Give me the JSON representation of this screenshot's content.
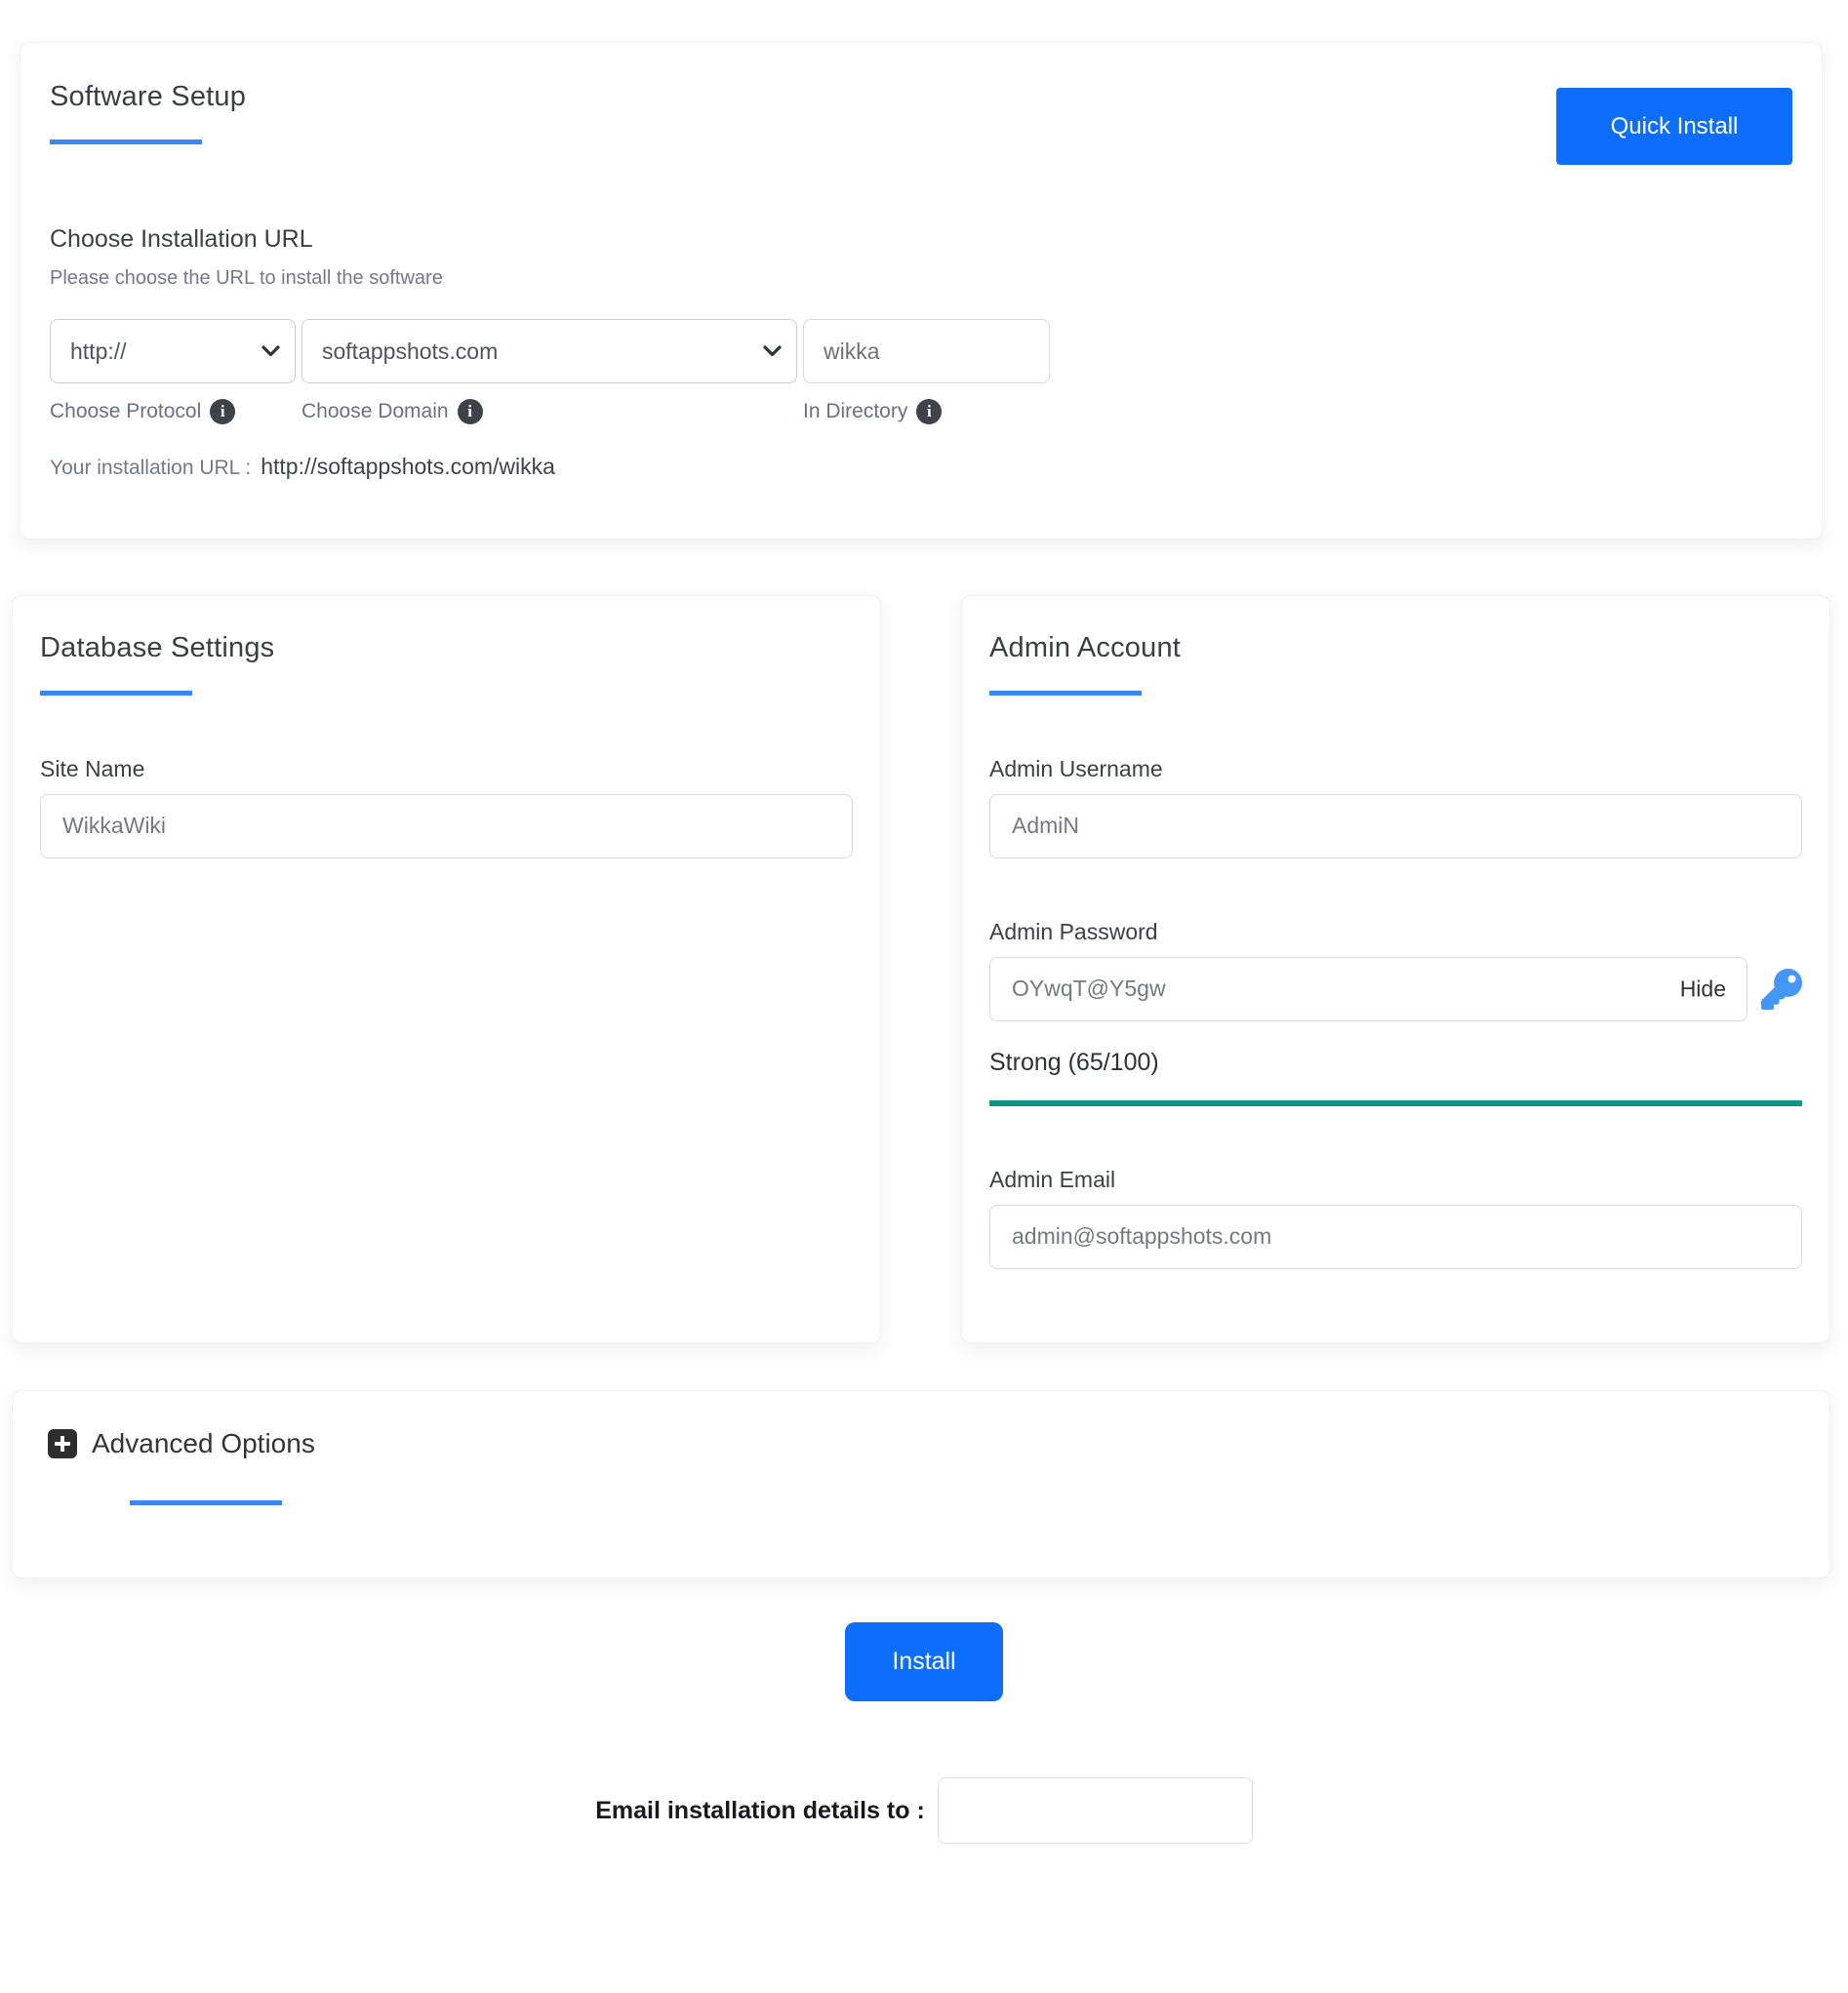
{
  "software_setup": {
    "title": "Software Setup",
    "quick_install_label": "Quick Install",
    "section_heading": "Choose Installation URL",
    "section_subtitle": "Please choose the URL to install the software",
    "protocol": {
      "value": "http://",
      "label": "Choose Protocol"
    },
    "domain": {
      "value": "softappshots.com",
      "label": "Choose Domain"
    },
    "directory": {
      "value": "wikka",
      "label": "In Directory"
    },
    "installation_url_label": "Your installation URL :",
    "installation_url_value": "http://softappshots.com/wikka"
  },
  "database_settings": {
    "title": "Database Settings",
    "site_name_label": "Site Name",
    "site_name_value": "WikkaWiki"
  },
  "admin_account": {
    "title": "Admin Account",
    "username_label": "Admin Username",
    "username_value": "AdmiN",
    "password_label": "Admin Password",
    "password_value": "OYwqT@Y5gw",
    "hide_label": "Hide",
    "strength_text": "Strong (65/100)",
    "strength_score": 65,
    "strength_max": 100,
    "email_label": "Admin Email",
    "email_value": "admin@softappshots.com"
  },
  "advanced_options": {
    "title": "Advanced Options"
  },
  "footer": {
    "install_button_label": "Install",
    "email_details_label": "Email installation details to :",
    "email_details_value": ""
  },
  "icons": {
    "info_glyph": "i"
  },
  "colors": {
    "accent_blue": "#0d6efd",
    "underline_blue": "#3d86f5",
    "strength_teal": "#0e9382",
    "key_icon_blue": "#4497f7",
    "info_icon_dark": "#3e4349"
  }
}
